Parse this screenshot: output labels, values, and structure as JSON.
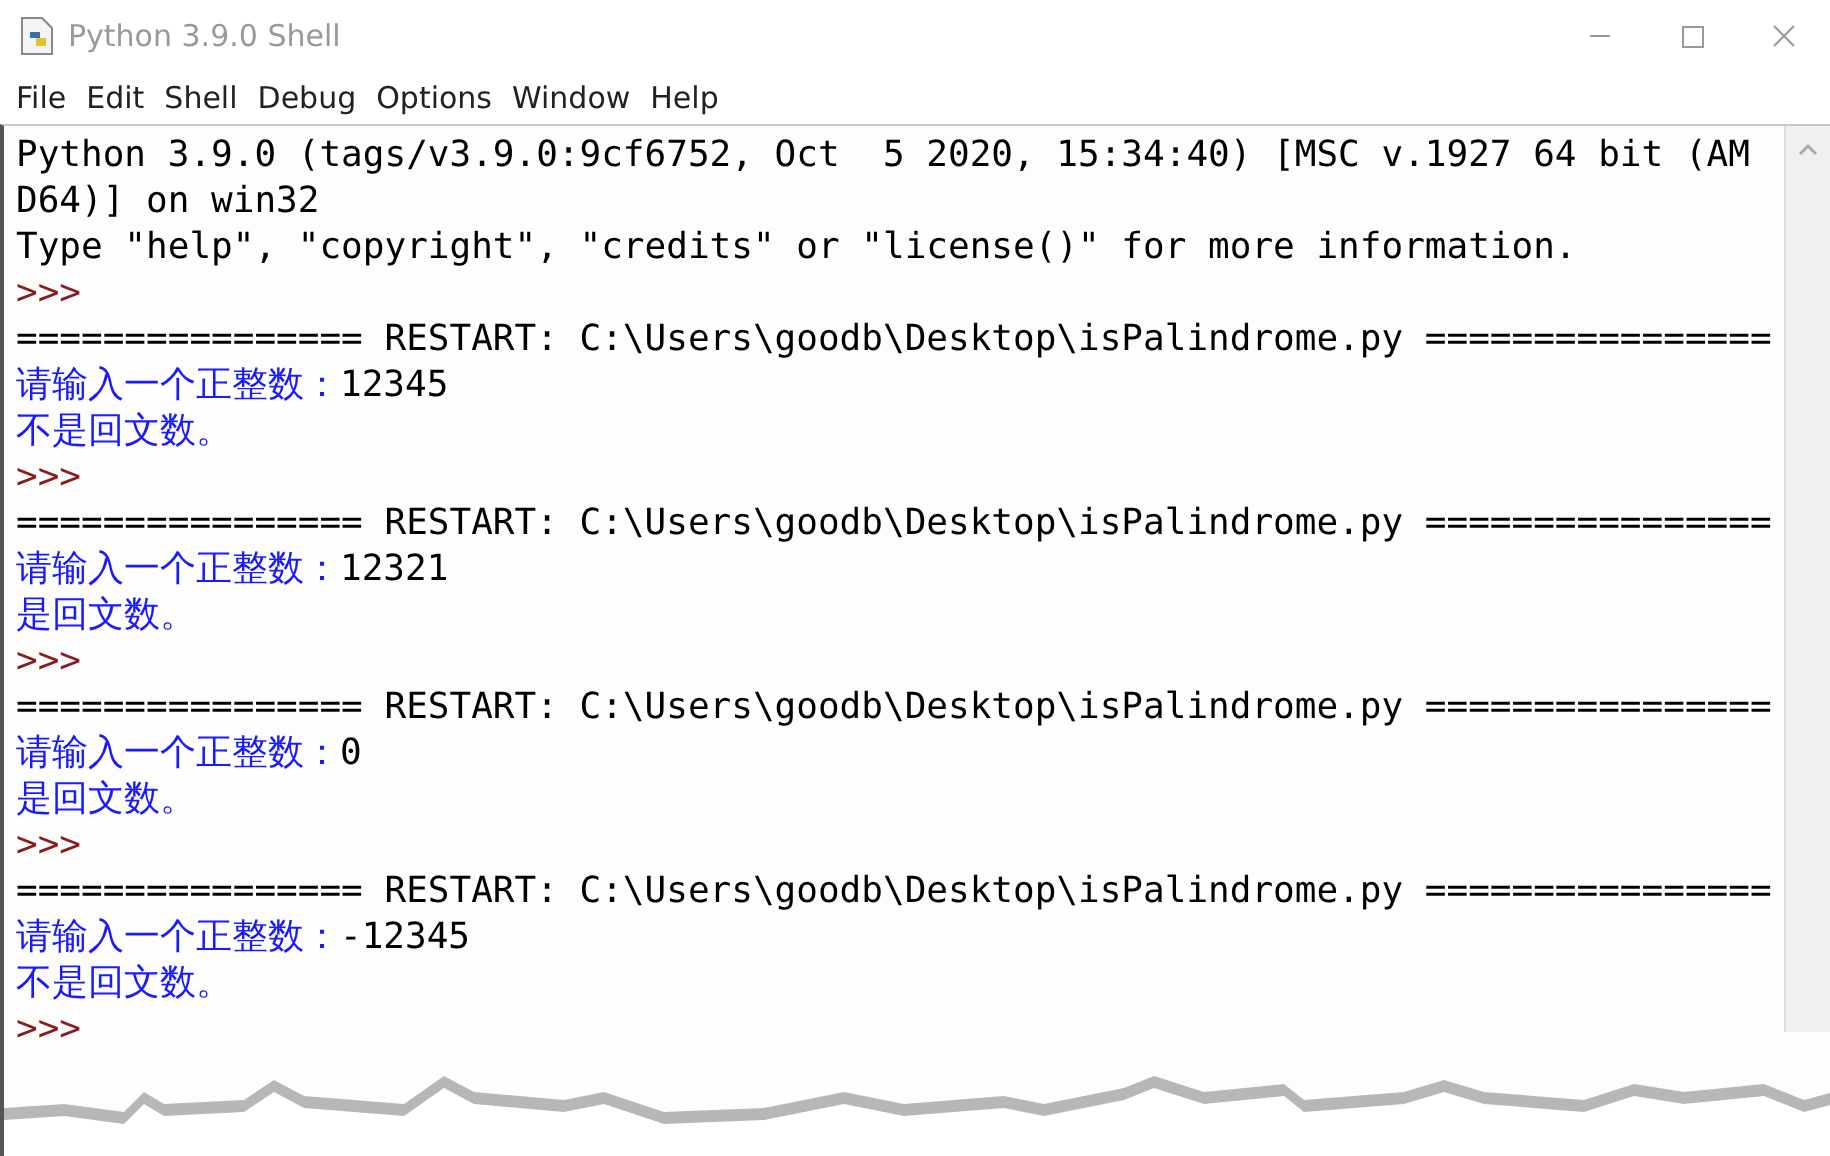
{
  "window": {
    "title": "Python 3.9.0 Shell"
  },
  "menu": [
    "File",
    "Edit",
    "Shell",
    "Debug",
    "Options",
    "Window",
    "Help"
  ],
  "lines": [
    {
      "kind": "output",
      "text": "Python 3.9.0 (tags/v3.9.0:9cf6752, Oct  5 2020, 15:34:40) [MSC v.1927 64 bit (AM"
    },
    {
      "kind": "output",
      "text": "D64)] on win32"
    },
    {
      "kind": "output",
      "text": "Type \"help\", \"copyright\", \"credits\" or \"license()\" for more information."
    },
    {
      "kind": "prompt",
      "text": ">>>"
    },
    {
      "kind": "restart",
      "text": "================ RESTART: C:\\Users\\goodb\\Desktop\\isPalindrome.py ================"
    },
    {
      "kind": "input",
      "prompt": "请输入一个正整数：",
      "value": "12345"
    },
    {
      "kind": "result",
      "text": "不是回文数。"
    },
    {
      "kind": "prompt",
      "text": ">>>"
    },
    {
      "kind": "restart",
      "text": "================ RESTART: C:\\Users\\goodb\\Desktop\\isPalindrome.py ================"
    },
    {
      "kind": "input",
      "prompt": "请输入一个正整数：",
      "value": "12321"
    },
    {
      "kind": "result",
      "text": "是回文数。"
    },
    {
      "kind": "prompt",
      "text": ">>>"
    },
    {
      "kind": "restart",
      "text": "================ RESTART: C:\\Users\\goodb\\Desktop\\isPalindrome.py ================"
    },
    {
      "kind": "input",
      "prompt": "请输入一个正整数：",
      "value": "0"
    },
    {
      "kind": "result",
      "text": "是回文数。"
    },
    {
      "kind": "prompt",
      "text": ">>>"
    },
    {
      "kind": "restart",
      "text": "================ RESTART: C:\\Users\\goodb\\Desktop\\isPalindrome.py ================"
    },
    {
      "kind": "input",
      "prompt": "请输入一个正整数：",
      "value": "-12345"
    },
    {
      "kind": "result",
      "text": "不是回文数。"
    },
    {
      "kind": "prompt",
      "text": ">>>"
    }
  ]
}
